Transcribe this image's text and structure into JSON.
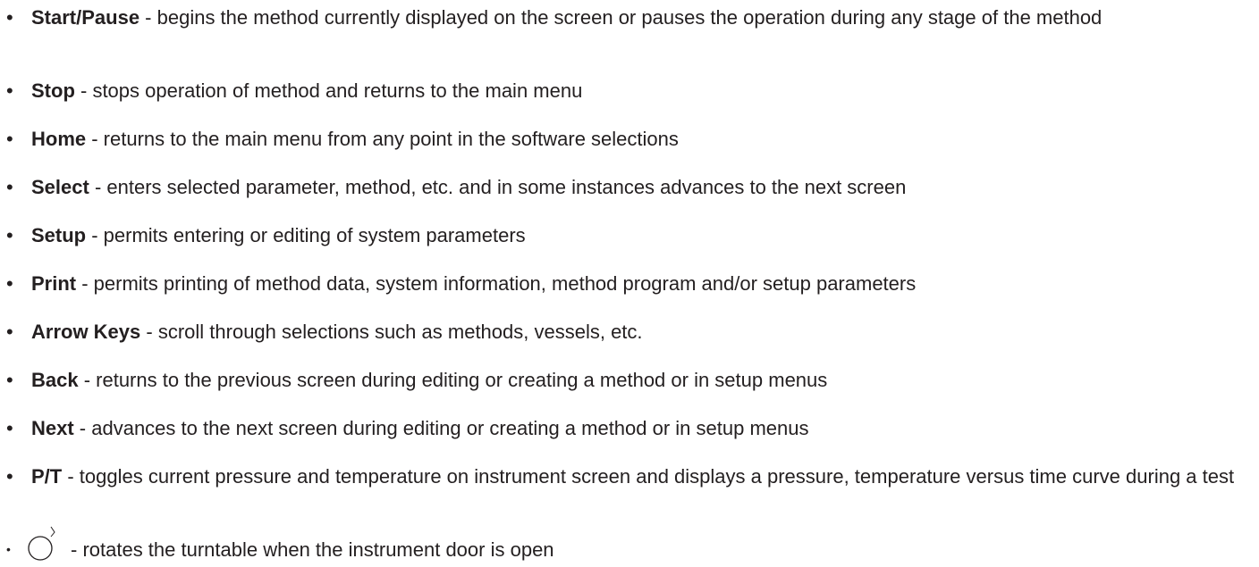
{
  "items": [
    {
      "term": "Start/Pause",
      "desc": " - begins the method currently displayed on the screen or pauses the operation during any stage of the method"
    },
    {
      "term": "Stop",
      "desc": " - stops operation of method and returns to the main menu"
    },
    {
      "term": "Home",
      "desc": " - returns to the main menu from any point in the software selections"
    },
    {
      "term": "Select",
      "desc": " - enters selected parameter, method, etc. and in some instances advances to the next screen"
    },
    {
      "term": "Setup",
      "desc": " - permits entering or editing of system parameters"
    },
    {
      "term": "Print",
      "desc": " - permits printing of method data, system information, method program and/or setup parameters"
    },
    {
      "term": "Arrow Keys",
      "desc": " - scroll through selections such as methods, vessels, etc."
    },
    {
      "term": "Back",
      "desc": " - returns to the previous screen during editing or creating a method or in setup menus"
    },
    {
      "term": "Next",
      "desc": " - advances to the next screen during editing or creating a method or in setup menus"
    },
    {
      "term": "P/T",
      "desc": " - toggles current pressure and temperature on instrument screen and displays a pressure, temperature versus time curve during a test"
    }
  ],
  "rotate_item": {
    "icon": "rotate-turntable-icon",
    "desc": "- rotates the turntable when the instrument door is open"
  }
}
